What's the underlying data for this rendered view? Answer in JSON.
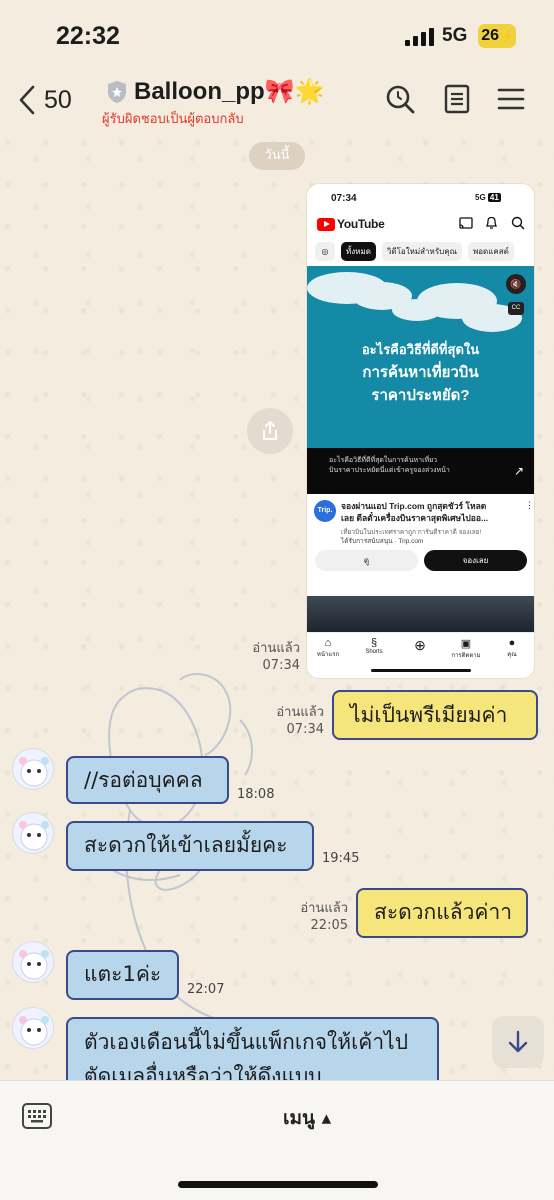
{
  "status_bar": {
    "time": "22:32",
    "network": "5G",
    "battery": "26"
  },
  "header": {
    "back_count": "50",
    "title": "Balloon_pp🎀🌟",
    "subtitle": "ผู้รับผิดชอบเป็นผู้ตอบกลับ",
    "icons": [
      "search-icon",
      "note-icon",
      "menu-icon"
    ]
  },
  "date_chip": "วันนี้",
  "image_message": {
    "read_label": "อ่านแล้ว",
    "time": "07:34",
    "screenshot": {
      "status_time": "07:34",
      "status_net": "5G",
      "status_batt": "41",
      "app_name": "YouTube",
      "chips": [
        "ทั้งหมด",
        "วิดีโอใหม่สำหรับคุณ",
        "พอดแคสต์"
      ],
      "video_text": [
        "อะไรคือวิธีที่ดีที่สุดใน",
        "การค้นหาเที่ยวบิน",
        "ราคาประหยัด?"
      ],
      "caption_line1": "อะไรคือวิธีที่ดีที่สุดในการค้นหาเที่ยว",
      "caption_line2": "บินราคาประหยัดนี่แต่เข้าครูจองล่วงหน้า",
      "ad_logo": "Trip.",
      "ad_title_1": "จองผ่านแอป Trip.com ถูกสุดชัวร์ โหลด",
      "ad_title_2": "เลย ดีลตั๋วเครื่องบินราคาสุดพิเศษไปออ...",
      "ad_desc": "เที่ยวบินในประเทศราคาถูก การันตีราคาดี จองเลย!",
      "ad_sponsor": "ได้รับการสนับสนุน · Trip.com",
      "ad_btn_view": "ดู",
      "ad_btn_book": "จองเลย",
      "nav": [
        "หน้าแรก",
        "Shorts",
        "",
        "การติดตาม",
        "คุณ"
      ]
    }
  },
  "messages": [
    {
      "dir": "out",
      "text": "ไม่เป็นพรีเมียมค่า",
      "read_label": "อ่านแล้ว",
      "time": "07:34"
    },
    {
      "dir": "in",
      "text": "//รอต่อบุคคล",
      "time": "18:08"
    },
    {
      "dir": "in",
      "text": "สะดวกให้เข้าเลยมั้ยคะ",
      "time": "19:45"
    },
    {
      "dir": "out",
      "text": "สะดวกแล้วค่าา",
      "read_label": "อ่านแล้ว",
      "time": "22:05"
    },
    {
      "dir": "in",
      "text": "แตะ1ค่ะ",
      "time": "22:07"
    },
    {
      "dir": "in",
      "text": "ตัวเองเดือนนี้ไม่ขึ้นแพ็กเกจให้เค้าไป",
      "text2": "ตัดเมลอื่นหรือว่าให้ดึงแบบ"
    }
  ],
  "bottom_bar": {
    "menu_label": "เมนู ▴"
  },
  "colors": {
    "outgoing_bubble": "#f6e57a",
    "incoming_bubble": "#b7d6ec",
    "bubble_border": "#3a4a8a",
    "background": "#f3ecdf"
  }
}
